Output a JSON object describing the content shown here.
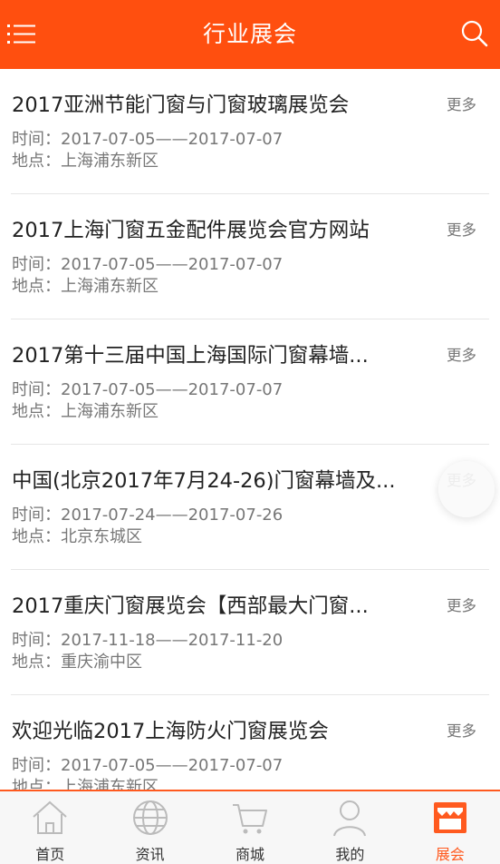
{
  "header": {
    "title": "行业展会",
    "menu_icon": "menu-icon",
    "search_icon": "search-icon"
  },
  "expos": [
    {
      "name": "2017亚洲节能门窗与门窗玻璃展览会",
      "more": "更多",
      "time": "时间：2017-07-05——2017-07-07",
      "place": "地点：上海浦东新区"
    },
    {
      "name": "2017上海门窗五金配件展览会官方网站",
      "more": "更多",
      "time": "时间：2017-07-05——2017-07-07",
      "place": "地点：上海浦东新区"
    },
    {
      "name": "2017第十三届中国上海国际门窗幕墙...",
      "more": "更多",
      "time": "时间：2017-07-05——2017-07-07",
      "place": "地点：上海浦东新区"
    },
    {
      "name": "中国(北京2017年7月24-26)门窗幕墙及...",
      "more": "更多",
      "time": "时间：2017-07-24——2017-07-26",
      "place": "地点：北京东城区"
    },
    {
      "name": "2017重庆门窗展览会【西部最大门窗...",
      "more": "更多",
      "time": "时间：2017-11-18——2017-11-20",
      "place": "地点：重庆渝中区"
    },
    {
      "name": "欢迎光临2017上海防火门窗展览会",
      "more": "更多",
      "time": "时间：2017-07-05——2017-07-07",
      "place": "地点：上海浦东新区"
    }
  ],
  "tabs": [
    {
      "label": "首页",
      "icon": "home-icon"
    },
    {
      "label": "资讯",
      "icon": "globe-icon"
    },
    {
      "label": "商城",
      "icon": "cart-icon"
    },
    {
      "label": "我的",
      "icon": "user-icon"
    },
    {
      "label": "展会",
      "icon": "expo-icon"
    }
  ],
  "colors": {
    "brand": "#ff4f0f",
    "active_tab": "#ff5a1f"
  }
}
